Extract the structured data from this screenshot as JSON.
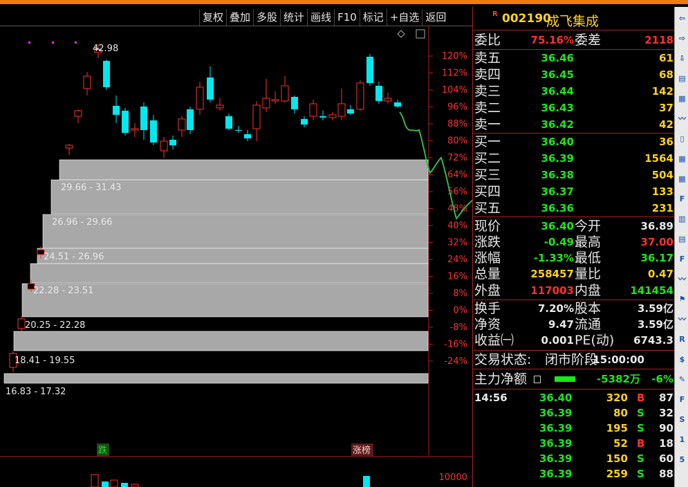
{
  "window": {
    "title_fragment": ""
  },
  "toolbar": {
    "buttons": [
      "复权",
      "叠加",
      "多股",
      "统计",
      "画线",
      "F10",
      "标记",
      "+自选",
      "返回"
    ]
  },
  "chart": {
    "price_labels": [
      "42.98",
      "29.66 - 31.43",
      "26.96 - 29.66",
      "24.51 - 26.96",
      "22.28 - 23.51",
      "20.25 - 22.28",
      "18.41 - 19.55",
      "16.83 - 17.32"
    ],
    "pct_axis": [
      "120%",
      "112%",
      "104%",
      "96%",
      "88%",
      "80%",
      "72%",
      "64%",
      "56%",
      "48%",
      "40%",
      "32%",
      "24%",
      "16%",
      "8%",
      "0%",
      "-8%",
      "-16%",
      "-24%"
    ],
    "volume_axis_label": "10000",
    "tags": {
      "drop_tag": "跌",
      "rank_tag": "涨榜"
    },
    "colors": {
      "up": "#ff3030",
      "down": "#00e8f0",
      "bar": "#a8a8a8",
      "trend": "#2fb84a",
      "axis": "#aa2222"
    }
  },
  "stock": {
    "badge": "R",
    "code": "002190",
    "name": "成飞集成"
  },
  "order_book": {
    "weibi_label": "委比",
    "weibi": "75.16%",
    "weicha_label": "委差",
    "weicha": "2118",
    "asks": [
      {
        "label": "卖五",
        "price": "36.46",
        "vol": "61"
      },
      {
        "label": "卖四",
        "price": "36.45",
        "vol": "68"
      },
      {
        "label": "卖三",
        "price": "36.44",
        "vol": "142"
      },
      {
        "label": "卖二",
        "price": "36.43",
        "vol": "37"
      },
      {
        "label": "卖一",
        "price": "36.42",
        "vol": "42"
      }
    ],
    "bids": [
      {
        "label": "买一",
        "price": "36.40",
        "vol": "36"
      },
      {
        "label": "买二",
        "price": "36.39",
        "vol": "1564"
      },
      {
        "label": "买三",
        "price": "36.38",
        "vol": "504"
      },
      {
        "label": "买四",
        "price": "36.37",
        "vol": "133"
      },
      {
        "label": "买五",
        "price": "36.36",
        "vol": "231"
      }
    ]
  },
  "quote": {
    "xianjia_label": "现价",
    "xianjia": "36.40",
    "jinkai_label": "今开",
    "jinkai": "36.89",
    "zhangdie_label": "涨跌",
    "zhangdie": "-0.49",
    "zuigao_label": "最高",
    "zuigao": "37.00",
    "zhangfu_label": "涨幅",
    "zhangfu": "-1.33%",
    "zuidi_label": "最低",
    "zuidi": "36.17",
    "zongliang_label": "总量",
    "zongliang": "258457",
    "liangbi_label": "量比",
    "liangbi": "0.47",
    "waipan_label": "外盘",
    "waipan": "117003",
    "neipan_label": "内盘",
    "neipan": "141454",
    "huanshou_label": "换手",
    "huanshou": "7.20%",
    "guben_label": "股本",
    "guben": "3.59亿",
    "jingzi_label": "净资",
    "jingzi": "9.47",
    "liutong_label": "流通",
    "liutong": "3.59亿",
    "shouyi_label": "收益㈠",
    "shouyi": "0.001",
    "pe_label": "PE(动)",
    "pe": "6743.3",
    "status_label": "交易状态:",
    "status": "闭市阶段",
    "status_time": "15:00:00",
    "zhuli_label": "主力净额",
    "zhuli": "-5382万",
    "zhuli_pct": "-6%"
  },
  "trades": [
    {
      "time": "14:56",
      "price": "36.40",
      "vol": "320",
      "side": "B",
      "n": "87"
    },
    {
      "time": "",
      "price": "36.39",
      "vol": "80",
      "side": "S",
      "n": "32"
    },
    {
      "time": "",
      "price": "36.39",
      "vol": "195",
      "side": "S",
      "n": "90"
    },
    {
      "time": "",
      "price": "36.39",
      "vol": "52",
      "side": "B",
      "n": "18"
    },
    {
      "time": "",
      "price": "36.39",
      "vol": "150",
      "side": "S",
      "n": "60"
    },
    {
      "time": "",
      "price": "36.39",
      "vol": "259",
      "side": "S",
      "n": "88"
    }
  ],
  "icon_strip": [
    "back-icon",
    "forward-icon",
    "down-icon",
    "kline-icon",
    "table-icon",
    "line-icon",
    "candle-icon",
    "grid-icon",
    "grid-icon",
    "fi-icon",
    "chart-icon",
    "flag-icon",
    "fs-icon",
    "chart2-icon",
    "flag2-icon",
    "trend-icon",
    "rs-icon",
    "money-icon",
    "pen-icon",
    "fs2-icon",
    "s-icon",
    "one-icon",
    "five-icon"
  ]
}
